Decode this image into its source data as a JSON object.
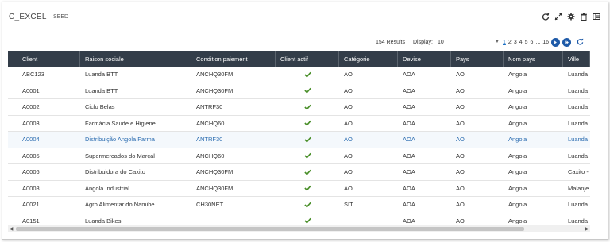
{
  "header": {
    "title": "C_EXCEL",
    "subtitle": "SEED"
  },
  "toolbar": {
    "icons": [
      "refresh-icon",
      "expand-icon",
      "gear-icon",
      "trash-icon",
      "columns-icon"
    ]
  },
  "pagination": {
    "results": "154 Results",
    "display_label": "Display:",
    "display_value": "10",
    "pages": [
      "1",
      "2",
      "3",
      "4",
      "5",
      "6",
      "...",
      "16"
    ],
    "active_page": "1"
  },
  "colors": {
    "header_bg": "#333d49",
    "check": "#4a8f2a",
    "link": "#2b6cb0",
    "nav_btn": "#1e5aa8"
  },
  "table": {
    "columns": [
      "Client",
      "Raison sociale",
      "Condition paiement",
      "Client actif",
      "Catégorie",
      "Devise",
      "Pays",
      "Nom pays",
      "Ville"
    ],
    "rows": [
      {
        "client": "ABC123",
        "raison": "Luanda BTT.",
        "condition": "ANCHQ30FM",
        "actif": true,
        "categorie": "AO",
        "devise": "AOA",
        "pays": "AO",
        "nom_pays": "Angola",
        "ville": "Luanda"
      },
      {
        "client": "A0001",
        "raison": "Luanda BTT.",
        "condition": "ANCHQ30FM",
        "actif": true,
        "categorie": "AO",
        "devise": "AOA",
        "pays": "AO",
        "nom_pays": "Angola",
        "ville": "Luanda"
      },
      {
        "client": "A0002",
        "raison": "Ciclo Belas",
        "condition": "ANTRF30",
        "actif": true,
        "categorie": "AO",
        "devise": "AOA",
        "pays": "AO",
        "nom_pays": "Angola",
        "ville": "Luanda"
      },
      {
        "client": "A0003",
        "raison": "Farmácia Saude e Higiene",
        "condition": "ANCHQ60",
        "actif": true,
        "categorie": "AO",
        "devise": "AOA",
        "pays": "AO",
        "nom_pays": "Angola",
        "ville": "Luanda"
      },
      {
        "client": "A0004",
        "raison": "Distribuição Angola Farma",
        "condition": "ANTRF30",
        "actif": true,
        "categorie": "AO",
        "devise": "AOA",
        "pays": "AO",
        "nom_pays": "Angola",
        "ville": "Luanda",
        "selected": true
      },
      {
        "client": "A0005",
        "raison": "Supermercados do Marçal",
        "condition": "ANCHQ60",
        "actif": true,
        "categorie": "AO",
        "devise": "AOA",
        "pays": "AO",
        "nom_pays": "Angola",
        "ville": "Luanda"
      },
      {
        "client": "A0006",
        "raison": "Distribuidora do Caxito",
        "condition": "ANCHQ30FM",
        "actif": true,
        "categorie": "AO",
        "devise": "AOA",
        "pays": "AO",
        "nom_pays": "Angola",
        "ville": "Caxito -"
      },
      {
        "client": "A0008",
        "raison": "Angola Industrial",
        "condition": "ANCHQ30FM",
        "actif": true,
        "categorie": "AO",
        "devise": "AOA",
        "pays": "AO",
        "nom_pays": "Angola",
        "ville": "Malanje"
      },
      {
        "client": "A0021",
        "raison": "Agro Alimentar do Namibe",
        "condition": "CH30NET",
        "actif": true,
        "categorie": "SIT",
        "devise": "AOA",
        "pays": "AO",
        "nom_pays": "Angola",
        "ville": "Luanda"
      },
      {
        "client": "A0151",
        "raison": "Luanda Bikes",
        "condition": "",
        "actif": true,
        "categorie": "",
        "devise": "AOA",
        "pays": "AO",
        "nom_pays": "Angola",
        "ville": "Luanda"
      }
    ]
  }
}
